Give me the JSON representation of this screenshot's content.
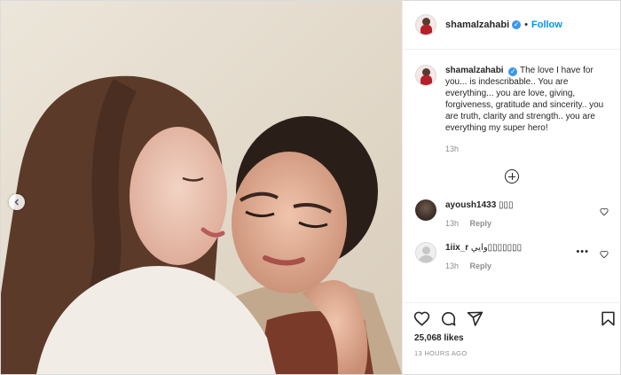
{
  "post": {
    "username": "shamalzahabi",
    "verified": true,
    "follow_label": "Follow",
    "header_separator": "•"
  },
  "caption": {
    "username": "shamalzahabi",
    "text": "The love I have for you... is indescribable.. You are everything... you are love, giving, forgiveness, gratitude and sincerity.. you are truth, clarity and strength.. you are everything my super hero!",
    "time": "13h"
  },
  "comments": [
    {
      "username": "ayoush1433",
      "text": "▯▯▯",
      "time": "13h",
      "reply_label": "Reply"
    },
    {
      "username": "1iix_r",
      "text": "وايي▯▯▯▯▯▯▯",
      "time": "13h",
      "reply_label": "Reply",
      "more": "•••"
    }
  ],
  "engagement": {
    "likes": "25,068 likes",
    "posted": "13 HOURS AGO"
  },
  "icons": [
    "prev-arrow",
    "verified-badge",
    "load-more-plus",
    "heart",
    "comment",
    "share",
    "bookmark"
  ]
}
